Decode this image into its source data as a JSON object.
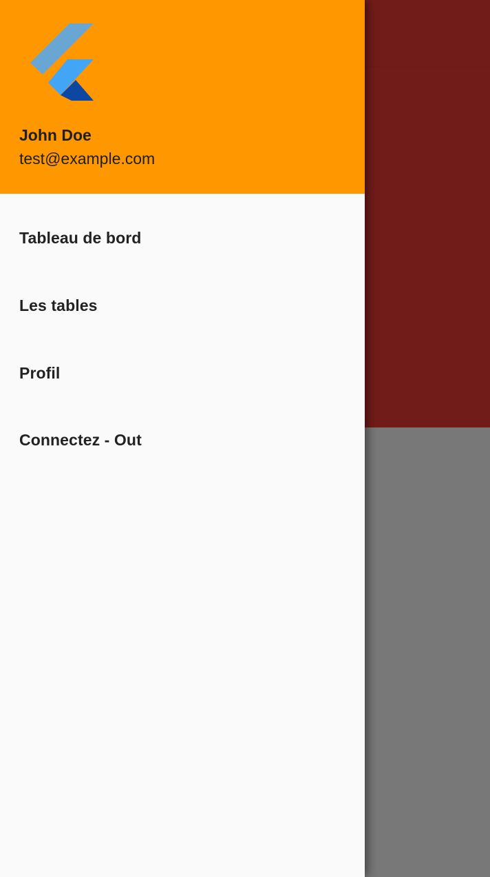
{
  "drawer": {
    "header": {
      "logo_icon": "flutter-logo-icon",
      "account_name": "John Doe",
      "account_email": "test@example.com",
      "background_color": "#ff9800"
    },
    "items": [
      {
        "label": "Tableau de bord"
      },
      {
        "label": "Les tables"
      },
      {
        "label": "Profil"
      },
      {
        "label": "Connectez - Out"
      }
    ]
  },
  "background_app": {
    "appbar_color": "#e53935",
    "scrim": "rgba(0,0,0,0.5)"
  }
}
